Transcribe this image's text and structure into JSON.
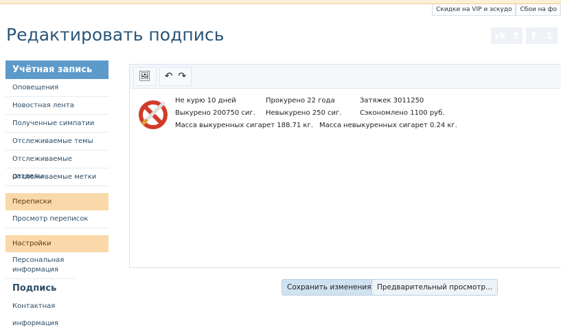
{
  "top_tabs": [
    "Скидки на VIP и эскудо",
    "Сбои на фо"
  ],
  "title": "Редактировать подпись",
  "social": {
    "vk": {
      "icon": "vk-icon",
      "label": "vk",
      "count": "5"
    },
    "fb": {
      "icon": "facebook-icon",
      "label": "f",
      "count": "1"
    }
  },
  "sidebar": {
    "account_header": "Учётная запись",
    "account_items": [
      "Оповещения",
      "Новостная лента",
      "Полученные симпатии",
      "Отслеживаемые темы",
      "Отслеживаемые разделы",
      "Отслеживаемые метки"
    ],
    "messages_header": "Переписки",
    "messages_items": [
      "Просмотр переписок"
    ],
    "settings_header": "Настройки",
    "settings_items": [
      "Персональная информация"
    ],
    "current": "Подпись",
    "next": "Контактная информация"
  },
  "signature": {
    "row1": [
      "Не курю 10 дней",
      "Прокурено 22 года",
      "Затяжек 3011250"
    ],
    "row2": [
      "Выкурено 200750 сиг.",
      "Невыкурено 250 сиг.",
      "Сэкономлено 1100 руб."
    ],
    "row3": [
      "Масса выкуренных сигарет 188.71 кг.",
      "Масса невыкуренных сигарет 0.24 кг."
    ]
  },
  "buttons": {
    "save": "Сохранить изменения",
    "preview": "Предварительный просмотр..."
  }
}
